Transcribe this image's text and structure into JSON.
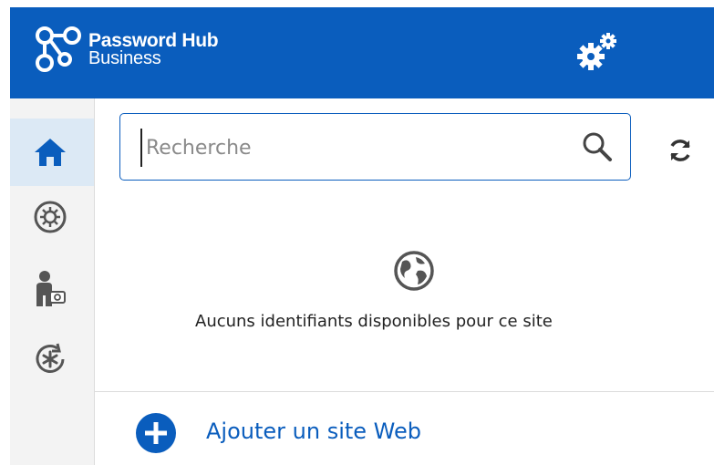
{
  "header": {
    "brand_name": "Password Hub",
    "brand_sub": "Business",
    "logo_icon": "chain-link-logo",
    "settings_icon": "gears-icon",
    "background_color": "#0a5dbd"
  },
  "sidebar": {
    "items": [
      {
        "name": "home",
        "icon": "home-icon",
        "active": true
      },
      {
        "name": "settings-vault",
        "icon": "vault-gear-icon",
        "active": false
      },
      {
        "name": "user-identity",
        "icon": "user-card-icon",
        "active": false
      },
      {
        "name": "password-generator",
        "icon": "asterisk-refresh-icon",
        "active": false
      }
    ]
  },
  "search": {
    "placeholder": "Recherche",
    "value": ""
  },
  "main": {
    "empty_icon": "globe-icon",
    "empty_message": "Aucuns identifiants disponibles pour ce site",
    "add_site_label": "Ajouter un site Web",
    "accent_color": "#0a5dbd"
  }
}
